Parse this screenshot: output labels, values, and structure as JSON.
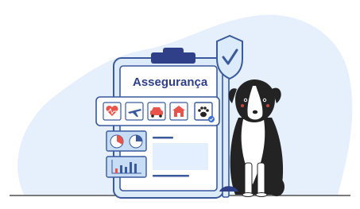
{
  "clipboard": {
    "title": "Assegurança",
    "insurance_options": [
      {
        "icon": "heart-health-icon",
        "selected": false
      },
      {
        "icon": "airplane-travel-icon",
        "selected": false
      },
      {
        "icon": "car-auto-icon",
        "selected": false
      },
      {
        "icon": "house-home-icon",
        "selected": false
      },
      {
        "icon": "paw-pet-icon",
        "selected": true
      }
    ]
  },
  "shield": {
    "icon": "shield-check-icon"
  },
  "colors": {
    "accent": "#3a5a9c",
    "light_blue": "#e3efff",
    "card_blue": "#c7dcf5",
    "red": "#e8534a",
    "dark": "#232323"
  }
}
